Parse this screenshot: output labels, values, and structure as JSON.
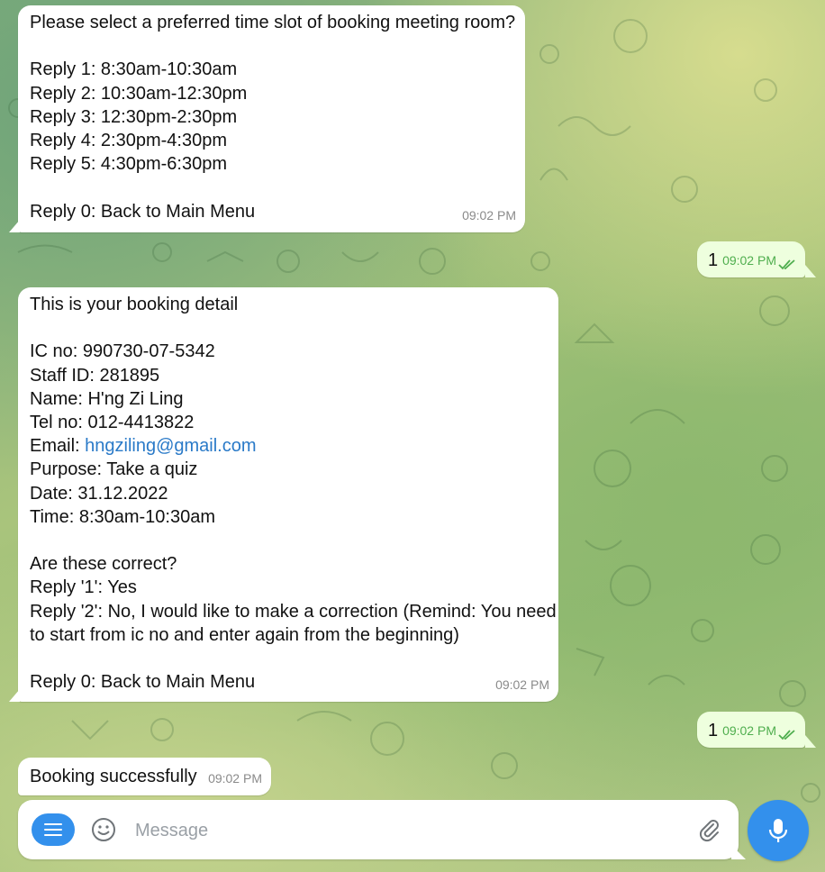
{
  "messages": {
    "timeslot": {
      "lines": [
        "Please select a preferred time slot of booking meeting room?",
        "",
        "Reply 1: 8:30am-10:30am",
        "Reply 2: 10:30am-12:30pm",
        "Reply 3: 12:30pm-2:30pm",
        "Reply 4: 2:30pm-4:30pm",
        "Reply 5: 4:30pm-6:30pm",
        "",
        "Reply 0: Back to Main Menu"
      ],
      "time": "09:02 PM"
    },
    "reply1": {
      "text": "1",
      "time": "09:02 PM"
    },
    "booking_detail": {
      "title": "This is your booking detail",
      "ic": "IC no: 990730-07-5342",
      "staff": "Staff ID: 281895",
      "name": "Name: H'ng Zi Ling",
      "tel": "Tel no: 012-4413822",
      "email_label": "Email: ",
      "email": "hngziling@gmail.com",
      "purpose": "Purpose: Take a quiz",
      "date": "Date: 31.12.2022",
      "timeslot": "Time: 8:30am-10:30am",
      "question": "Are these correct?",
      "opt1": "Reply '1': Yes",
      "opt2a": "Reply '2': No, I would like to make a correction (Remind: You need",
      "opt2b": "to start from ic no and enter again from the beginning)",
      "back": "Reply 0: Back to Main Menu",
      "time": "09:02 PM"
    },
    "reply2": {
      "text": "1",
      "time": "09:02 PM"
    },
    "success": {
      "text": "Booking successfully",
      "time": "09:02 PM"
    }
  },
  "composer": {
    "placeholder": "Message"
  },
  "colors": {
    "accent": "#3390ec",
    "outgoing_bubble": "#eeffde",
    "read_check": "#4fae4e",
    "link": "#2a7ac8"
  },
  "icons": [
    "menu-icon",
    "emoji-icon",
    "paperclip-icon",
    "microphone-icon",
    "double-check-icon"
  ]
}
